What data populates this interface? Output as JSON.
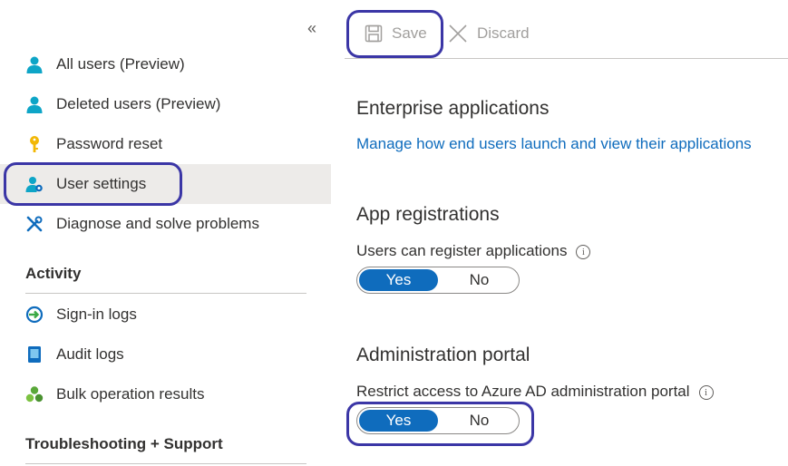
{
  "sidebar": {
    "collapse_glyph": "«",
    "items": [
      {
        "label": "All users (Preview)",
        "icon": "user-icon"
      },
      {
        "label": "Deleted users (Preview)",
        "icon": "user-icon"
      },
      {
        "label": "Password reset",
        "icon": "key-icon"
      },
      {
        "label": "User settings",
        "icon": "user-settings-icon",
        "selected": true
      },
      {
        "label": "Diagnose and solve problems",
        "icon": "wrench-icon"
      }
    ],
    "activity": {
      "title": "Activity",
      "items": [
        {
          "label": "Sign-in logs",
          "icon": "sign-in-icon"
        },
        {
          "label": "Audit logs",
          "icon": "audit-log-icon"
        },
        {
          "label": "Bulk operation results",
          "icon": "bulk-operation-icon"
        }
      ]
    },
    "troubleshooting": {
      "title": "Troubleshooting + Support"
    }
  },
  "toolbar": {
    "save_label": "Save",
    "discard_label": "Discard"
  },
  "main": {
    "enterprise": {
      "title": "Enterprise applications",
      "link": "Manage how end users launch and view their applications"
    },
    "app_registrations": {
      "title": "App registrations",
      "field_label": "Users can register applications",
      "info_glyph": "i",
      "options": [
        "Yes",
        "No"
      ],
      "selected": "Yes"
    },
    "admin_portal": {
      "title": "Administration portal",
      "field_label": "Restrict access to Azure AD administration portal",
      "info_glyph": "i",
      "options": [
        "Yes",
        "No"
      ],
      "selected": "Yes"
    }
  },
  "colors": {
    "accent": "#0f6cbd",
    "highlight_outline": "#3b36a6",
    "selected_bg": "#edebe9"
  }
}
